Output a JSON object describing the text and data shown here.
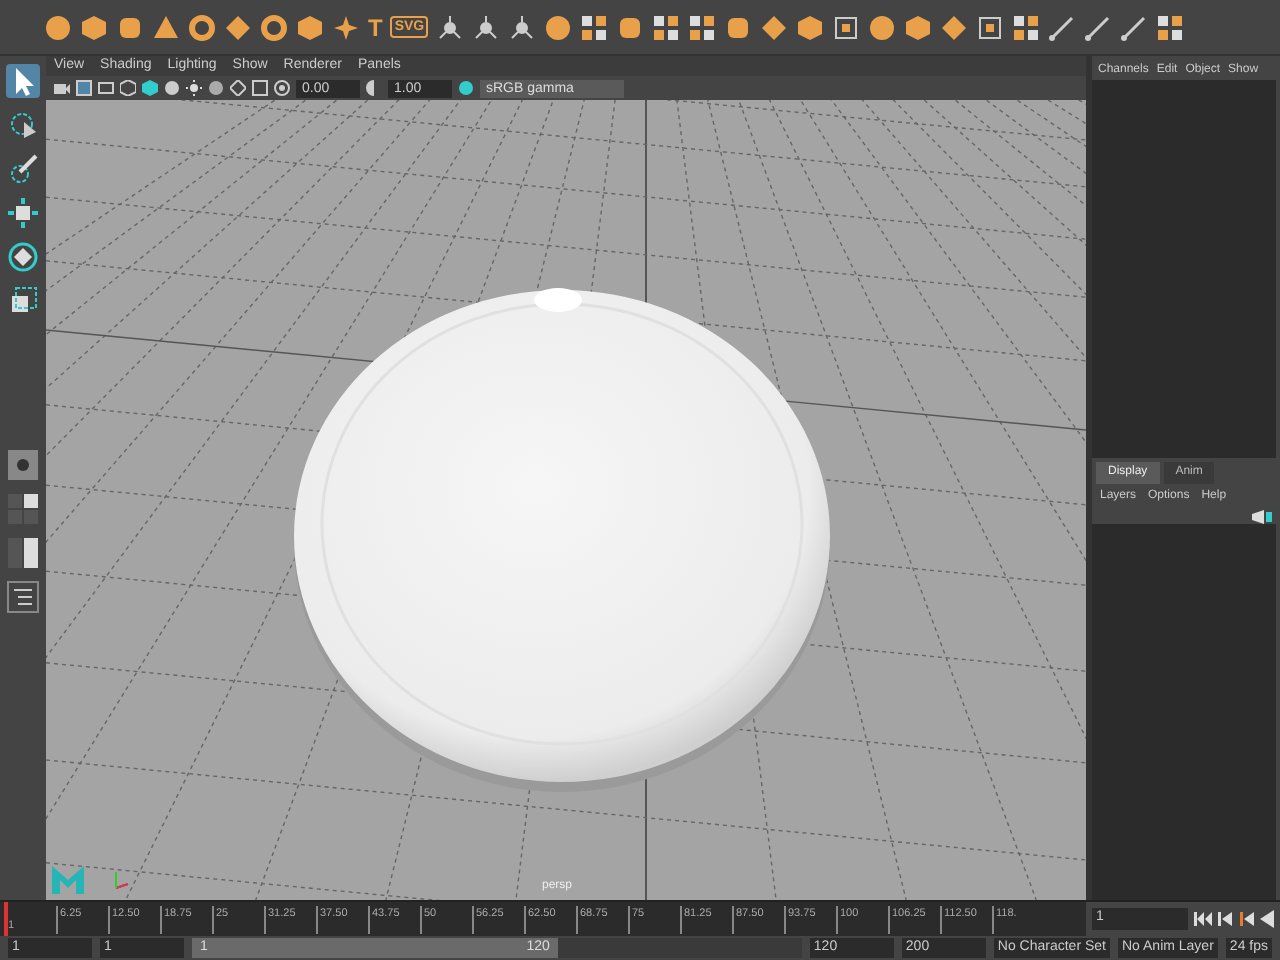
{
  "shelf": {
    "text_icons": [
      "T",
      "SVG"
    ]
  },
  "viewport_menu": [
    "View",
    "Shading",
    "Lighting",
    "Show",
    "Renderer",
    "Panels"
  ],
  "viewport_toolbar": {
    "exposure": "0.00",
    "gamma": "1.00",
    "color_space": "sRGB gamma"
  },
  "camera_label": "persp",
  "channel_box": {
    "menu": [
      "Channels",
      "Edit",
      "Object",
      "Show"
    ]
  },
  "layer_editor": {
    "tabs": [
      {
        "label": "Display",
        "selected": true
      },
      {
        "label": "Anim",
        "selected": false
      }
    ],
    "menu": [
      "Layers",
      "Options",
      "Help"
    ]
  },
  "timeline": {
    "ticks": [
      "1",
      "6.25",
      "12.50",
      "18.75",
      "25",
      "31.25",
      "37.50",
      "43.75",
      "50",
      "56.25",
      "62.50",
      "68.75",
      "75",
      "81.25",
      "87.50",
      "93.75",
      "100",
      "106.25",
      "112.50",
      "118."
    ],
    "current_frame": "1",
    "level": 0
  },
  "range_slider": {
    "start": "1",
    "playback_start": "1",
    "range_start": "1",
    "range_end": "120",
    "level": 0.6,
    "playback_end": "120",
    "end": "200",
    "character_set": "No Character Set",
    "anim_layer": "No Anim Layer",
    "fps": "24 fps"
  }
}
